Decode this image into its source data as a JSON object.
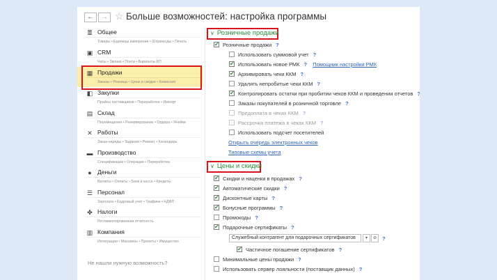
{
  "window": {
    "back": "←",
    "forward": "→",
    "title": "Больше возможностей: настройка программы"
  },
  "sidebar": {
    "sections": [
      {
        "label": "Общее",
        "sub": "Товары • Единицы измерения • Штрихкоды • Печать",
        "icon": "≣",
        "icon_name": "list-icon"
      },
      {
        "label": "CRM",
        "sub": "Чаты • Звонки • Почта • Варианты КП",
        "icon": "▣",
        "icon_name": "crm-icon"
      },
      {
        "label": "Продажи",
        "sub": "Заказы • Розница • Цены и скидки • Комиссия",
        "icon": "▦",
        "icon_name": "sales-icon"
      },
      {
        "label": "Закупки",
        "sub": "Прайсы поставщиков • Переработка • Импорт",
        "icon": "◧",
        "icon_name": "purchases-icon"
      },
      {
        "label": "Склад",
        "sub": "Перемещения • Резервирование • Ордера • Ячейки",
        "icon": "▤",
        "icon_name": "warehouse-icon"
      },
      {
        "label": "Работы",
        "sub": "Заказ-наряды • Задания • Ремонт • Календарь",
        "icon": "✕",
        "icon_name": "tools-icon"
      },
      {
        "label": "Производство",
        "sub": "Спецификации • Операции • Переработка",
        "icon": "▬",
        "icon_name": "factory-icon"
      },
      {
        "label": "Деньги",
        "sub": "Валюты • Оплаты • Банк и касса • Кредиты",
        "icon": "●",
        "icon_name": "money-icon"
      },
      {
        "label": "Персонал",
        "sub": "Зарплата • Кадровый учет • Графики • НДФЛ",
        "icon": "☰",
        "icon_name": "staff-icon"
      },
      {
        "label": "Налоги",
        "sub": "Регламентированная отчетность",
        "icon": "✤",
        "icon_name": "taxes-icon"
      },
      {
        "label": "Компания",
        "sub": "Интеграции • Магазины • Проекты • Имущество",
        "icon": "▥",
        "icon_name": "company-icon"
      }
    ],
    "footer": "Не нашли нужную возможность?"
  },
  "retail": {
    "header": "Розничные продажи",
    "rows": [
      {
        "label": "Розничные продажи",
        "checked": true,
        "q": true,
        "indent": 0
      },
      {
        "label": "Использовать суммовой учет",
        "checked": false,
        "q": true,
        "indent": 1
      },
      {
        "label": "Использовать новое РМК",
        "checked": true,
        "q": true,
        "indent": 1,
        "link": "Помощник настройки РМК"
      },
      {
        "label": "Архивировать чеки ККМ",
        "checked": true,
        "q": true,
        "indent": 1
      },
      {
        "label": "Удалять непробитые чеки ККМ",
        "checked": false,
        "q": true,
        "indent": 1
      },
      {
        "label": "Контролировать остатки при пробитии чеков ККМ и проведении отчетов",
        "checked": true,
        "q": true,
        "indent": 1
      },
      {
        "label": "Заказы покупателей в розничной торговле",
        "checked": false,
        "q": true,
        "indent": 1
      },
      {
        "label": "Предоплата в чеках ККМ",
        "checked": false,
        "q": true,
        "indent": 1,
        "dim": true
      },
      {
        "label": "Рассрочка платежа в чеках ККМ",
        "checked": false,
        "q": true,
        "indent": 1,
        "dim": true
      },
      {
        "label": "Использовать подсчет посетителей",
        "checked": false,
        "q": false,
        "indent": 1
      }
    ],
    "links": [
      "Открыть очередь электронных чеков",
      "Типовые схемы учета"
    ]
  },
  "prices": {
    "header": "Цены и скидки",
    "rows": [
      {
        "label": "Скидки и наценки в продажах",
        "checked": true,
        "q": true,
        "indent": 0
      },
      {
        "label": "Автоматические скидки",
        "checked": true,
        "q": true,
        "indent": 0
      },
      {
        "label": "Дисконтные карты",
        "checked": true,
        "q": true,
        "indent": 0
      },
      {
        "label": "Бонусные программы",
        "checked": true,
        "q": true,
        "indent": 0
      },
      {
        "label": "Промокоды",
        "checked": false,
        "q": true,
        "indent": 0
      },
      {
        "label": "Подарочные сертификаты",
        "checked": true,
        "q": true,
        "indent": 0
      }
    ],
    "combo_value": "Служебный контрагент для подарочных сертификатов",
    "partial": {
      "label": "Частичное погашение сертификатов",
      "checked": true
    },
    "tail_rows": [
      {
        "label": "Минимальные цены продажи",
        "checked": false,
        "q": true
      },
      {
        "label": "Использовать сервер лояльности (поставщик данных)",
        "checked": false,
        "q": true
      }
    ]
  },
  "colors": {
    "accent_green": "#2e8b3c",
    "highlight": "#fbedaa",
    "callout_red": "#d8131b",
    "link_blue": "#2f63b8"
  }
}
